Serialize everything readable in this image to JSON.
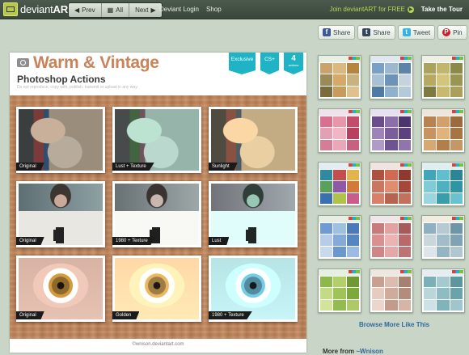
{
  "topbar": {
    "logo_prefix": "deviant",
    "logo_suffix": "ART",
    "prev_label": "Prev",
    "all_label": "All",
    "next_label": "Next",
    "links": [
      "Deviant Login",
      "Shop"
    ],
    "join_label": "Join deviantART for FREE",
    "tour_label": "Take the Tour"
  },
  "share": {
    "buttons": [
      {
        "label": "Share",
        "icon": "f",
        "icon_name": "facebook-icon",
        "color": "#3b5998"
      },
      {
        "label": "Share",
        "icon": "t",
        "icon_name": "tumblr-icon",
        "color": "#35465c"
      },
      {
        "label": "Tweet",
        "icon": "t",
        "icon_name": "twitter-icon",
        "color": "#33b5e8"
      },
      {
        "label": "Pin",
        "icon": "P",
        "icon_name": "pinterest-icon",
        "color": "#cb2027"
      }
    ]
  },
  "art": {
    "title": "Warm & Vintage",
    "subtitle": "Photoshop Actions",
    "notice": "Do not reproduce, copy with, publish, transmit or upload in any way.",
    "ribbons": {
      "exclusive": "Exclusive",
      "cs": "CS+",
      "count": "4",
      "count_sub": "actions"
    },
    "photos": [
      {
        "label": "Original",
        "kind": "girl v1"
      },
      {
        "label": "Lust + Texture",
        "kind": "girl v2"
      },
      {
        "label": "Sunlight",
        "kind": "girl v3"
      },
      {
        "label": "Original",
        "kind": "model v1"
      },
      {
        "label": "1980 + Texture",
        "kind": "model v2"
      },
      {
        "label": "Lust",
        "kind": "model v3"
      },
      {
        "label": "Original",
        "kind": "eye v1"
      },
      {
        "label": "Golden",
        "kind": "eye v2"
      },
      {
        "label": "1980 + Texture",
        "kind": "eye v3"
      }
    ],
    "credit": "wnison.deviantart.com"
  },
  "thumbnails": [
    {
      "band": "#e8efe4",
      "colors": [
        "#c9a36c",
        "#dbb880",
        "#b7843f",
        "#9a8a5a",
        "#d6a96a",
        "#c9b27f",
        "#7c6a3f",
        "#c89a5b",
        "#e0c08e"
      ]
    },
    {
      "band": "#dfe8f0",
      "colors": [
        "#7aa1c3",
        "#9cb8cf",
        "#5b84a8",
        "#a8c0d3",
        "#6d93b8",
        "#c3d4e0",
        "#4f7aa3",
        "#8fb1cd",
        "#b4c9da"
      ]
    },
    {
      "band": "#eef0e6",
      "colors": [
        "#a9a35e",
        "#c2b56c",
        "#8c8a49",
        "#b7a962",
        "#d4c57c",
        "#9b9553",
        "#7e7b40",
        "#c8b96f",
        "#aaa05a"
      ]
    },
    {
      "band": "#f0e2ea",
      "colors": [
        "#d9708f",
        "#e896a9",
        "#c24c6a",
        "#e2a0b4",
        "#f0b6c4",
        "#b8405e",
        "#d47d95",
        "#e9a7b8",
        "#c9607d"
      ]
    },
    {
      "band": "#e6e1f0",
      "colors": [
        "#6a4d8a",
        "#8b6eaa",
        "#4c3470",
        "#9d83b8",
        "#7a5d9a",
        "#5c4080",
        "#b09ac8",
        "#6e5292",
        "#8f74ad"
      ]
    },
    {
      "band": "#efe6db",
      "colors": [
        "#b9834f",
        "#d2a06a",
        "#9c6a3c",
        "#c79360",
        "#e0b27c",
        "#a87444",
        "#d8a872",
        "#b47e4a",
        "#c89664"
      ]
    },
    {
      "band": "#e4eef0",
      "colors": [
        "#2f8aa0",
        "#c44d4d",
        "#e3b44c",
        "#5aa05a",
        "#8e5aa8",
        "#d27a3a",
        "#3a6fb0",
        "#b0c24a",
        "#c95c8a"
      ]
    },
    {
      "band": "#f0e4e0",
      "colors": [
        "#b0503f",
        "#d06a52",
        "#8f3a2e",
        "#c9785f",
        "#e08c6e",
        "#a3483a",
        "#d9806a",
        "#b86250",
        "#c5705a"
      ]
    },
    {
      "band": "#e0eef0",
      "colors": [
        "#3fa7b7",
        "#5fbfcd",
        "#2a8594",
        "#7fcbd6",
        "#4fb1c0",
        "#2f94a4",
        "#9ad6df",
        "#3a9dac",
        "#68c2cf"
      ]
    },
    {
      "band": "#e6eee4",
      "colors": [
        "#6f9bd0",
        "#a0c0e0",
        "#4a7bb8",
        "#b7cde6",
        "#86aad8",
        "#5586c2",
        "#c9d9ec",
        "#6b97cc",
        "#9bbbe0"
      ]
    },
    {
      "band": "#f0e6e8",
      "colors": [
        "#c77b7b",
        "#e2a2a2",
        "#a65a5a",
        "#d89090",
        "#eab4b4",
        "#b86a6a",
        "#cf8686",
        "#e4a8a8",
        "#bf7474"
      ]
    },
    {
      "band": "#f0ece0",
      "colors": [
        "#8fb0c0",
        "#b7c9d2",
        "#6f95a8",
        "#c9d6dc",
        "#a2bdca",
        "#7fa3b5",
        "#dce5e9",
        "#95b4c3",
        "#b0c7d1"
      ]
    },
    {
      "band": "#e6f0e0",
      "colors": [
        "#8fb84a",
        "#b2cf6c",
        "#6f9a32",
        "#c4db86",
        "#9fc25a",
        "#7ca83c",
        "#d2e49a",
        "#93bc50",
        "#aeca66"
      ]
    },
    {
      "band": "#eee6e0",
      "colors": [
        "#c8a090",
        "#dcbcae",
        "#a88070",
        "#e6ccc0",
        "#d0aa9a",
        "#b48c7c",
        "#ecd6cc",
        "#c49a8a",
        "#d8b4a6"
      ]
    },
    {
      "band": "#e4eef0",
      "colors": [
        "#7bb0b8",
        "#a4c9ce",
        "#5c969f",
        "#b9d7db",
        "#8dbcc3",
        "#6aa3ac",
        "#cce2e5",
        "#80b4bc",
        "#9fc6cc"
      ]
    }
  ],
  "browse_label": "Browse More Like This",
  "more_from_label": "More from",
  "more_from_user": "~Wnison"
}
